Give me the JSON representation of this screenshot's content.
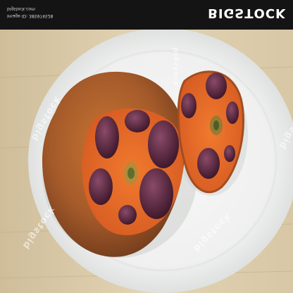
{
  "photo": {
    "subject": "cut fruit halves on white plate",
    "colors": {
      "table": "#d9c8a7",
      "plate": "#f4f5f4",
      "peel": "#b0652c",
      "flesh": "#e4682b",
      "seeds": "#4e2338",
      "bar": "#141414"
    }
  },
  "topbar": {
    "brand": "BIGSTOCK",
    "image_id": "Image ID: 385974528",
    "site": "bigstock.com"
  },
  "watermarks": [
    "bigstock",
    "bigstock",
    "bigstock",
    "bigstock",
    "bigstock"
  ]
}
